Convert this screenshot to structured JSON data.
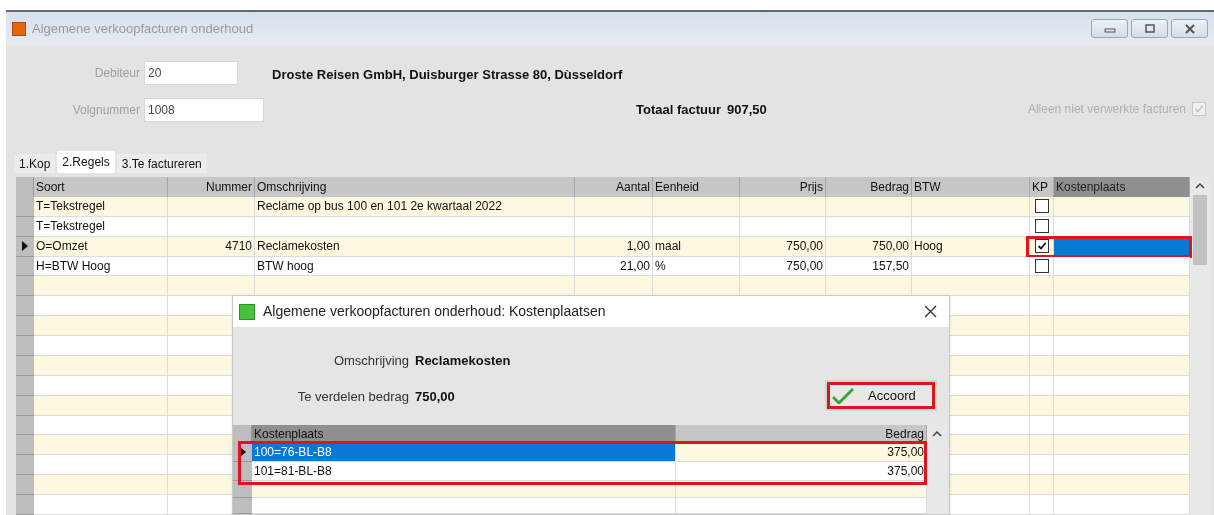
{
  "window": {
    "title": "Algemene verkoopfacturen onderhoud"
  },
  "header": {
    "debiteur": {
      "label": "Debiteur",
      "value": "20"
    },
    "volgnummer": {
      "label": "Volgnummer",
      "value": "1008"
    },
    "customer": "Droste Reisen GmbH, Duisburger Strasse 80, Dùsseldorf",
    "total": {
      "label": "Totaal factuur",
      "value": "907,50"
    },
    "filter": {
      "label": "Alleen niet verwerkte facturen",
      "checked": true
    }
  },
  "tabs": [
    {
      "label": "1.Kop",
      "selected": false
    },
    {
      "label": "2.Regels",
      "selected": true
    },
    {
      "label": "3.Te factureren",
      "selected": false
    }
  ],
  "grid": {
    "columns": [
      {
        "label": "Soort",
        "kind": "text",
        "selected": false
      },
      {
        "label": "Nummer",
        "kind": "number",
        "selected": false
      },
      {
        "label": "Omschrijving",
        "kind": "text",
        "selected": false
      },
      {
        "label": "Aantal",
        "kind": "number",
        "selected": false
      },
      {
        "label": "Eenheid",
        "kind": "text",
        "selected": false
      },
      {
        "label": "Prijs",
        "kind": "number",
        "selected": false
      },
      {
        "label": "Bedrag",
        "kind": "number",
        "selected": false
      },
      {
        "label": "BTW",
        "kind": "text",
        "selected": false
      },
      {
        "label": "KP",
        "kind": "check",
        "selected": false
      },
      {
        "label": "Kostenplaats",
        "kind": "text",
        "selected": true
      }
    ],
    "rows": [
      {
        "soort": "T=Tekstregel",
        "omschrijving": "Reclame op bus 100 en 101 2e kwartaal 2022",
        "kp": false,
        "selected": false,
        "annotated": false
      },
      {
        "soort": "T=Tekstregel",
        "kp": false,
        "selected": false,
        "annotated": false
      },
      {
        "soort": "O=Omzet",
        "nummer": "4710",
        "omschrijving": "Reclamekosten",
        "aantal": "1,00",
        "eenheid": "maal",
        "prijs": "750,00",
        "bedrag": "750,00",
        "btw": "Hoog",
        "kp": true,
        "selected": true,
        "annotated": true
      },
      {
        "soort": "H=BTW Hoog",
        "omschrijving": "BTW hoog",
        "aantal": "21,00",
        "eenheid": "%",
        "prijs": "750,00",
        "bedrag": "157,50",
        "kp": false,
        "selected": false,
        "annotated": false
      }
    ]
  },
  "dialog": {
    "title": "Algemene verkoopfacturen onderhoud: Kostenplaatsen",
    "omschrijving": {
      "label": "Omschrijving",
      "value": "Reclamekosten"
    },
    "bedrag": {
      "label": "Te verdelen bedrag",
      "value": "750,00"
    },
    "button": {
      "label": "Accoord",
      "annotated": true
    },
    "grid": {
      "annotated": true,
      "columns": [
        {
          "label": "Kostenplaats",
          "kind": "text",
          "selected": true
        },
        {
          "label": "Bedrag",
          "kind": "number",
          "selected": false
        }
      ],
      "rows": [
        {
          "cells": [
            "100=76-BL-B8",
            "375,00"
          ],
          "selected": true
        },
        {
          "cells": [
            "101=81-BL-B8",
            "375,00"
          ],
          "selected": false
        }
      ]
    }
  }
}
